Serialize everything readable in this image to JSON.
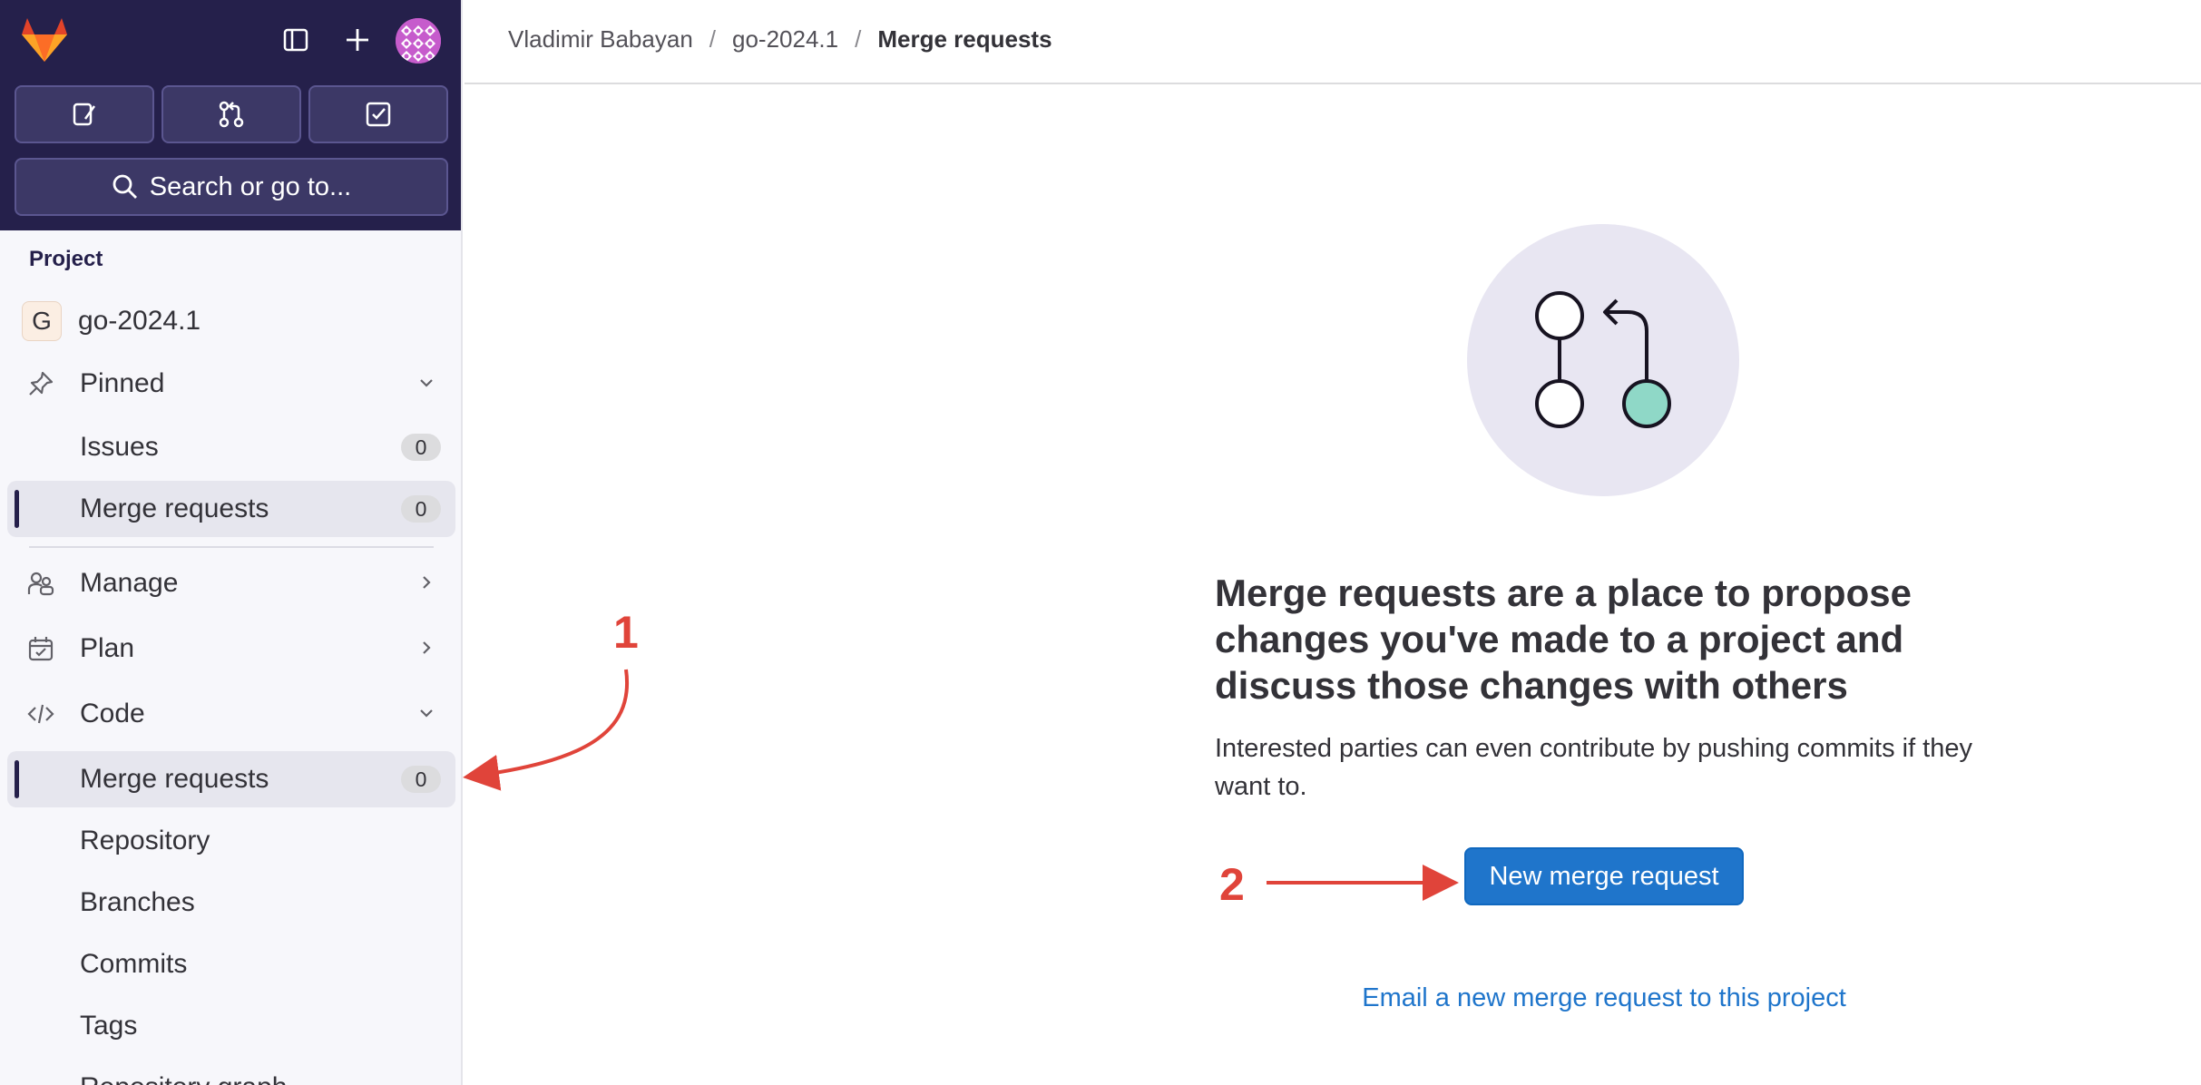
{
  "sidebar": {
    "search_label": "Search or go to...",
    "section_label": "Project",
    "project": {
      "initial": "G",
      "name": "go-2024.1"
    },
    "pinned": {
      "label": "Pinned",
      "issues": "Issues",
      "issues_count": "0",
      "merge_requests": "Merge requests",
      "merge_requests_count": "0"
    },
    "manage": "Manage",
    "plan": "Plan",
    "code": {
      "label": "Code",
      "merge_requests": "Merge requests",
      "merge_requests_count": "0",
      "repository": "Repository",
      "branches": "Branches",
      "commits": "Commits",
      "tags": "Tags",
      "repository_graph": "Repository graph"
    }
  },
  "header": {
    "breadcrumb": [
      "Vladimir Babayan",
      "go-2024.1",
      "Merge requests"
    ]
  },
  "empty_state": {
    "title": "Merge requests are a place to propose changes you've made to a project and discuss those changes with others",
    "description": "Interested parties can even contribute by pushing commits if they want to.",
    "primary_button": "New merge request",
    "email_link": "Email a new merge request to this project"
  },
  "annotations": {
    "one": "1",
    "two": "2"
  },
  "colors": {
    "sidebar_top": "#25204b",
    "primary": "#1f75cb",
    "annotation": "#e0443a",
    "illustration_bg": "#e8e6f2",
    "illustration_accent": "#8fd8c7"
  }
}
